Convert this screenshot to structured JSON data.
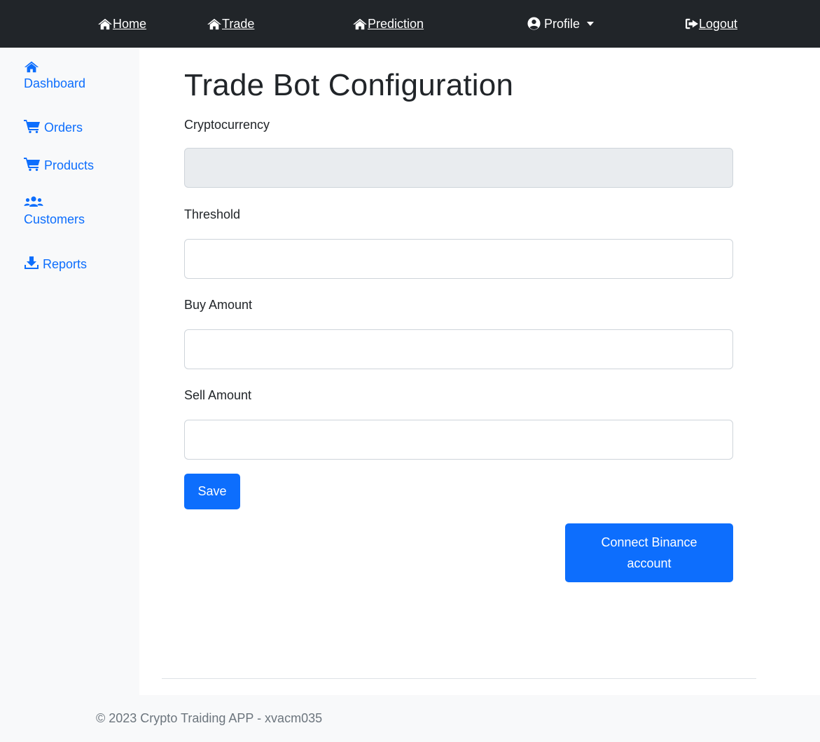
{
  "topnav": {
    "home": {
      "label": "Home",
      "icon": "home-icon"
    },
    "trade": {
      "label": "Trade",
      "icon": "home-icon"
    },
    "prediction": {
      "label": "Prediction",
      "icon": "home-icon"
    },
    "profile": {
      "label": "Profile",
      "icon": "user-circle-icon"
    },
    "logout": {
      "label": "Logout",
      "icon": "sign-out-icon"
    }
  },
  "sidebar": {
    "items": [
      {
        "label": "Dashboard",
        "icon": "home-icon"
      },
      {
        "label": "Orders",
        "icon": "shopping-cart-icon"
      },
      {
        "label": "Products",
        "icon": "shopping-cart-icon"
      },
      {
        "label": "Customers",
        "icon": "users-icon"
      },
      {
        "label": "Reports",
        "icon": "download-icon"
      }
    ]
  },
  "main": {
    "title": "Trade Bot Configuration",
    "fields": {
      "cryptocurrency": {
        "label": "Cryptocurrency",
        "value": ""
      },
      "threshold": {
        "label": "Threshold",
        "value": ""
      },
      "buy_amount": {
        "label": "Buy Amount",
        "value": ""
      },
      "sell_amount": {
        "label": "Sell Amount",
        "value": ""
      }
    },
    "save_label": "Save",
    "connect_label": "Connect Binance account"
  },
  "footer": {
    "text": "© 2023 Crypto Traiding APP - xvacm035"
  },
  "colors": {
    "navbar": "#212529",
    "accent": "#0d6efd",
    "sidebar_bg": "#f8f9fa",
    "disabled_input": "#e9ecef"
  }
}
